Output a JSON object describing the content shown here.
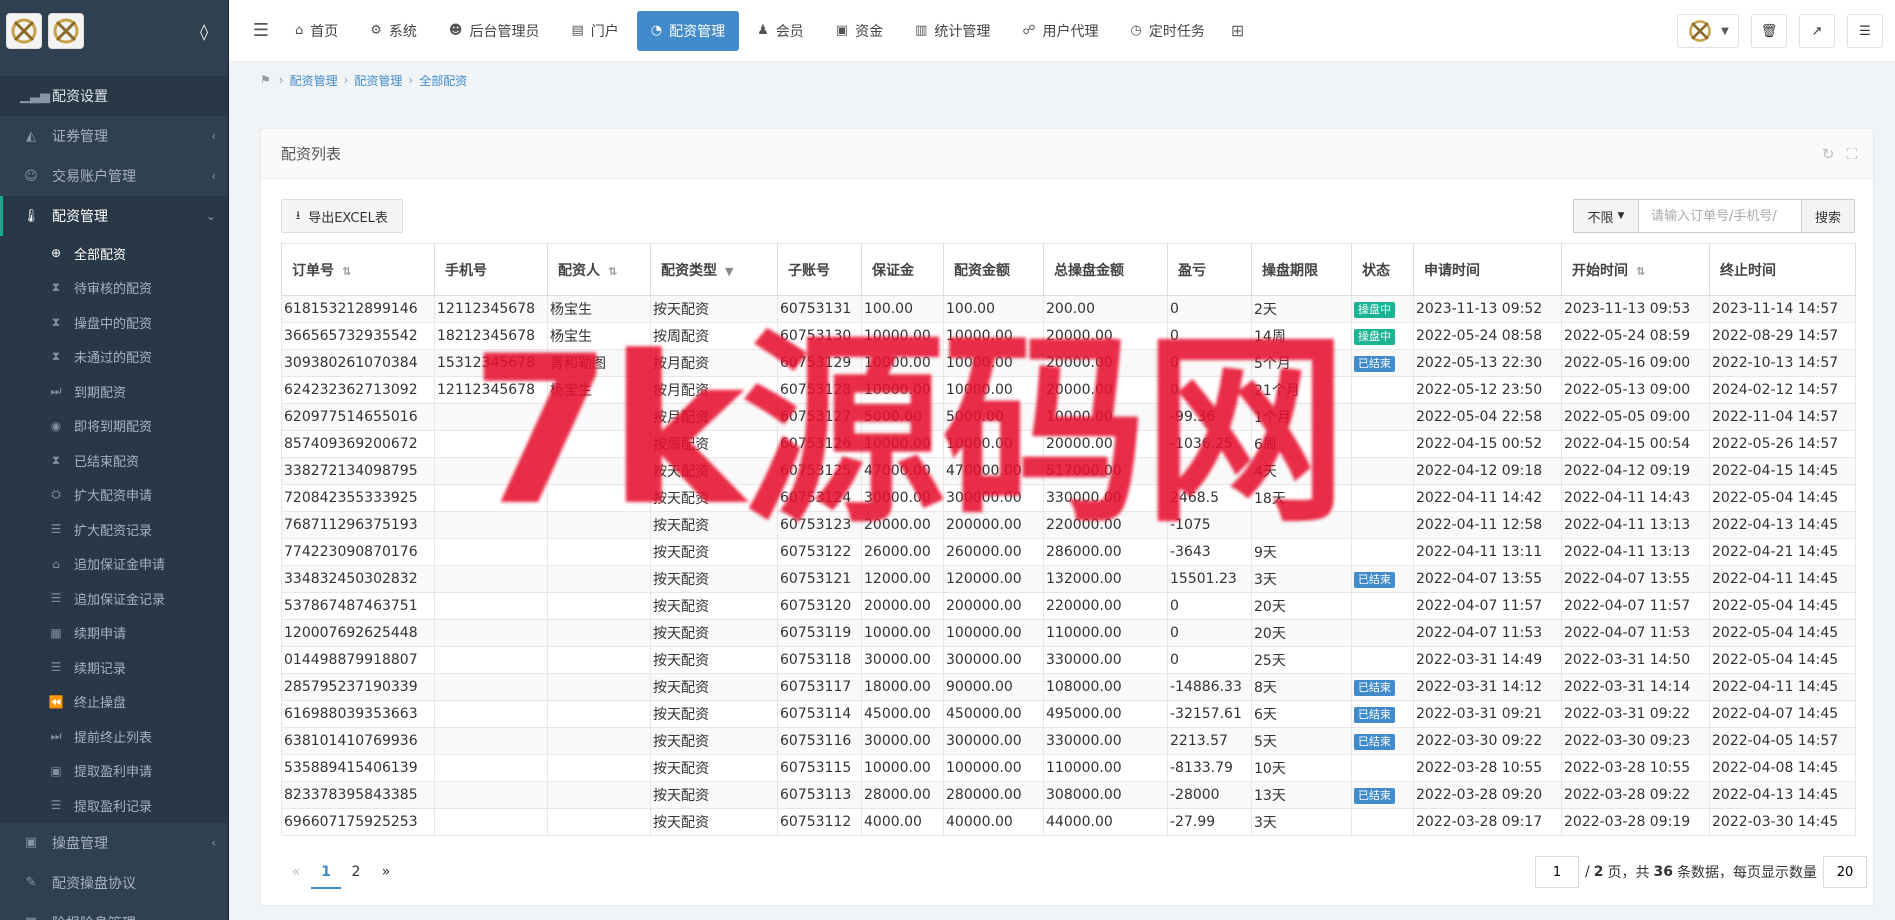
{
  "sidebar": {
    "items_top": [
      {
        "label": "配资设置",
        "icon": "chart-bar-icon",
        "arrow": ""
      },
      {
        "label": "证券管理",
        "icon": "area-chart-icon",
        "arrow": "‹"
      },
      {
        "label": "交易账户管理",
        "icon": "user-circle-icon",
        "arrow": "‹"
      },
      {
        "label": "配资管理",
        "icon": "thermometer-icon",
        "arrow": "⌄"
      }
    ],
    "subitems": [
      {
        "label": "全部配资",
        "icon": "globe-icon"
      },
      {
        "label": "待审核的配资",
        "icon": "hourglass-icon"
      },
      {
        "label": "操盘中的配资",
        "icon": "hourglass-icon"
      },
      {
        "label": "未通过的配资",
        "icon": "hourglass-icon"
      },
      {
        "label": "到期配资",
        "icon": "step-icon"
      },
      {
        "label": "即将到期配资",
        "icon": "camera-icon"
      },
      {
        "label": "已结束配资",
        "icon": "hourglass-icon"
      },
      {
        "label": "扩大配资申请",
        "icon": "stamp-icon"
      },
      {
        "label": "扩大配资记录",
        "icon": "list-icon"
      },
      {
        "label": "追加保证金申请",
        "icon": "bank-icon"
      },
      {
        "label": "追加保证金记录",
        "icon": "list-icon"
      },
      {
        "label": "续期申请",
        "icon": "file-icon"
      },
      {
        "label": "续期记录",
        "icon": "list-icon"
      },
      {
        "label": "终止操盘",
        "icon": "backward-icon"
      },
      {
        "label": "提前终止列表",
        "icon": "step-icon"
      },
      {
        "label": "提取盈利申请",
        "icon": "save-icon"
      },
      {
        "label": "提取盈利记录",
        "icon": "list-icon"
      }
    ],
    "items_bottom": [
      {
        "label": "操盘管理",
        "icon": "save-icon",
        "arrow": "‹"
      },
      {
        "label": "配资操盘协议",
        "icon": "pencil-icon",
        "arrow": ""
      },
      {
        "label": "险报险息管理",
        "icon": "file-icon",
        "arrow": ""
      }
    ]
  },
  "topnav": {
    "tabs": [
      {
        "label": "首页",
        "icon": "home-icon",
        "glyph": "⌂"
      },
      {
        "label": "系统",
        "icon": "gear-icon",
        "glyph": "⚙"
      },
      {
        "label": "后台管理员",
        "icon": "user-icon",
        "glyph": "☻"
      },
      {
        "label": "门户",
        "icon": "newspaper-icon",
        "glyph": "▤"
      },
      {
        "label": "配资管理",
        "icon": "pie-icon",
        "glyph": "◔"
      },
      {
        "label": "会员",
        "icon": "users-icon",
        "glyph": "♟"
      },
      {
        "label": "资金",
        "icon": "money-icon",
        "glyph": "▣"
      },
      {
        "label": "统计管理",
        "icon": "bar-chart-icon",
        "glyph": "▥"
      },
      {
        "label": "用户代理",
        "icon": "sitemap-icon",
        "glyph": "☍"
      },
      {
        "label": "定时任务",
        "icon": "clock-icon",
        "glyph": "◷"
      }
    ],
    "active_index": 4
  },
  "breadcrumb": [
    "配资管理",
    "配资管理",
    "全部配资"
  ],
  "panel": {
    "title": "配资列表",
    "export_label": "导出EXCEL表",
    "filter_select": "不限",
    "search_placeholder": "请输入订单号/手机号/",
    "search_button": "搜索"
  },
  "table": {
    "columns": [
      "订单号",
      "手机号",
      "配资人",
      "配资类型",
      "子账号",
      "保证金",
      "配资金额",
      "总操盘金额",
      "盈亏",
      "操盘期限",
      "状态",
      "申请时间",
      "开始时间",
      "终止时间"
    ],
    "rows": [
      [
        "618153212899146",
        "12112345678",
        "杨宝生",
        "按天配资",
        "60753131",
        "100.00",
        "100.00",
        "200.00",
        "0",
        "2天",
        "操盘中",
        "2023-11-13 09:52",
        "2023-11-13 09:53",
        "2023-11-14 14:57"
      ],
      [
        "366565732935542",
        "18212345678",
        "杨宝生",
        "按周配资",
        "60753130",
        "10000.00",
        "10000.00",
        "20000.00",
        "0",
        "14周",
        "操盘中",
        "2022-05-24 08:58",
        "2022-05-24 08:59",
        "2022-08-29 14:57"
      ],
      [
        "309380261070384",
        "15312345678",
        "青和勒图",
        "按月配资",
        "60753129",
        "10000.00",
        "10000.00",
        "20000.00",
        "0",
        "5个月",
        "已结束",
        "2022-05-13 22:30",
        "2022-05-16 09:00",
        "2022-10-13 14:57"
      ],
      [
        "624232362713092",
        "12112345678",
        "杨宝生",
        "按月配资",
        "60753128",
        "10000.00",
        "10000.00",
        "20000.00",
        "0",
        "21个月",
        "",
        "2022-05-12 23:50",
        "2022-05-13 09:00",
        "2024-02-12 14:57"
      ],
      [
        "620977514655016",
        "",
        "",
        "按月配资",
        "60753127",
        "5000.00",
        "5000.00",
        "10000.00",
        "-99.36",
        "1个月",
        "",
        "2022-05-04 22:58",
        "2022-05-05 09:00",
        "2022-11-04 14:57"
      ],
      [
        "857409369200672",
        "",
        "",
        "按周配资",
        "60753126",
        "10000.00",
        "10000.00",
        "20000.00",
        "-1036.25",
        "6周",
        "",
        "2022-04-15 00:52",
        "2022-04-15 00:54",
        "2022-05-26 14:57"
      ],
      [
        "338272134098795",
        "",
        "",
        "按天配资",
        "60753125",
        "47000.00",
        "470000.00",
        "517000.00",
        "",
        "4天",
        "",
        "2022-04-12 09:18",
        "2022-04-12 09:19",
        "2022-04-15 14:45"
      ],
      [
        "720842355333925",
        "",
        "",
        "按天配资",
        "60753124",
        "30000.00",
        "300000.00",
        "330000.00",
        "2468.5",
        "18天",
        "",
        "2022-04-11 14:42",
        "2022-04-11 14:43",
        "2022-05-04 14:45"
      ],
      [
        "768711296375193",
        "",
        "",
        "按天配资",
        "60753123",
        "20000.00",
        "200000.00",
        "220000.00",
        "-1075",
        "",
        "",
        "2022-04-11 12:58",
        "2022-04-11 13:13",
        "2022-04-13 14:45"
      ],
      [
        "774223090870176",
        "",
        "",
        "按天配资",
        "60753122",
        "26000.00",
        "260000.00",
        "286000.00",
        "-3643",
        "9天",
        "",
        "2022-04-11 13:11",
        "2022-04-11 13:13",
        "2022-04-21 14:45"
      ],
      [
        "334832450302832",
        "",
        "",
        "按天配资",
        "60753121",
        "12000.00",
        "120000.00",
        "132000.00",
        "15501.23",
        "3天",
        "已结束",
        "2022-04-07 13:55",
        "2022-04-07 13:55",
        "2022-04-11 14:45"
      ],
      [
        "537867487463751",
        "",
        "",
        "按天配资",
        "60753120",
        "20000.00",
        "200000.00",
        "220000.00",
        "0",
        "20天",
        "",
        "2022-04-07 11:57",
        "2022-04-07 11:57",
        "2022-05-04 14:45"
      ],
      [
        "120007692625448",
        "",
        "",
        "按天配资",
        "60753119",
        "10000.00",
        "100000.00",
        "110000.00",
        "0",
        "20天",
        "",
        "2022-04-07 11:53",
        "2022-04-07 11:53",
        "2022-05-04 14:45"
      ],
      [
        "014498879918807",
        "",
        "",
        "按天配资",
        "60753118",
        "30000.00",
        "300000.00",
        "330000.00",
        "0",
        "25天",
        "",
        "2022-03-31 14:49",
        "2022-03-31 14:50",
        "2022-05-04 14:45"
      ],
      [
        "285795237190339",
        "",
        "",
        "按天配资",
        "60753117",
        "18000.00",
        "90000.00",
        "108000.00",
        "-14886.33",
        "8天",
        "已结束",
        "2022-03-31 14:12",
        "2022-03-31 14:14",
        "2022-04-11 14:45"
      ],
      [
        "616988039353663",
        "",
        "",
        "按天配资",
        "60753114",
        "45000.00",
        "450000.00",
        "495000.00",
        "-32157.61",
        "6天",
        "已结束",
        "2022-03-31 09:21",
        "2022-03-31 09:22",
        "2022-04-07 14:45"
      ],
      [
        "638101410769936",
        "",
        "",
        "按天配资",
        "60753116",
        "30000.00",
        "300000.00",
        "330000.00",
        "2213.57",
        "5天",
        "已结束",
        "2022-03-30 09:22",
        "2022-03-30 09:23",
        "2022-04-05 14:57"
      ],
      [
        "535889415406139",
        "",
        "",
        "按天配资",
        "60753115",
        "10000.00",
        "100000.00",
        "110000.00",
        "-8133.79",
        "10天",
        "",
        "2022-03-28 10:55",
        "2022-03-28 10:55",
        "2022-04-08 14:45"
      ],
      [
        "823378395843385",
        "",
        "",
        "按天配资",
        "60753113",
        "28000.00",
        "280000.00",
        "308000.00",
        "-28000",
        "13天",
        "已结束",
        "2022-03-28 09:20",
        "2022-03-28 09:22",
        "2022-04-13 14:45"
      ],
      [
        "696607175925253",
        "",
        "",
        "按天配资",
        "60753112",
        "4000.00",
        "40000.00",
        "44000.00",
        "-27.99",
        "3天",
        "",
        "2022-03-28 09:17",
        "2022-03-28 09:19",
        "2022-03-30 14:45"
      ]
    ]
  },
  "pagination": {
    "prev": "«",
    "pages": [
      "1",
      "2"
    ],
    "next": "»",
    "current_input": "1",
    "text_slash": "/",
    "total_pages": "2",
    "text_pages": "页，共",
    "total_items": "36",
    "text_items": "条数据，每页显示数量",
    "page_size": "20"
  },
  "watermark": "7k源码网"
}
